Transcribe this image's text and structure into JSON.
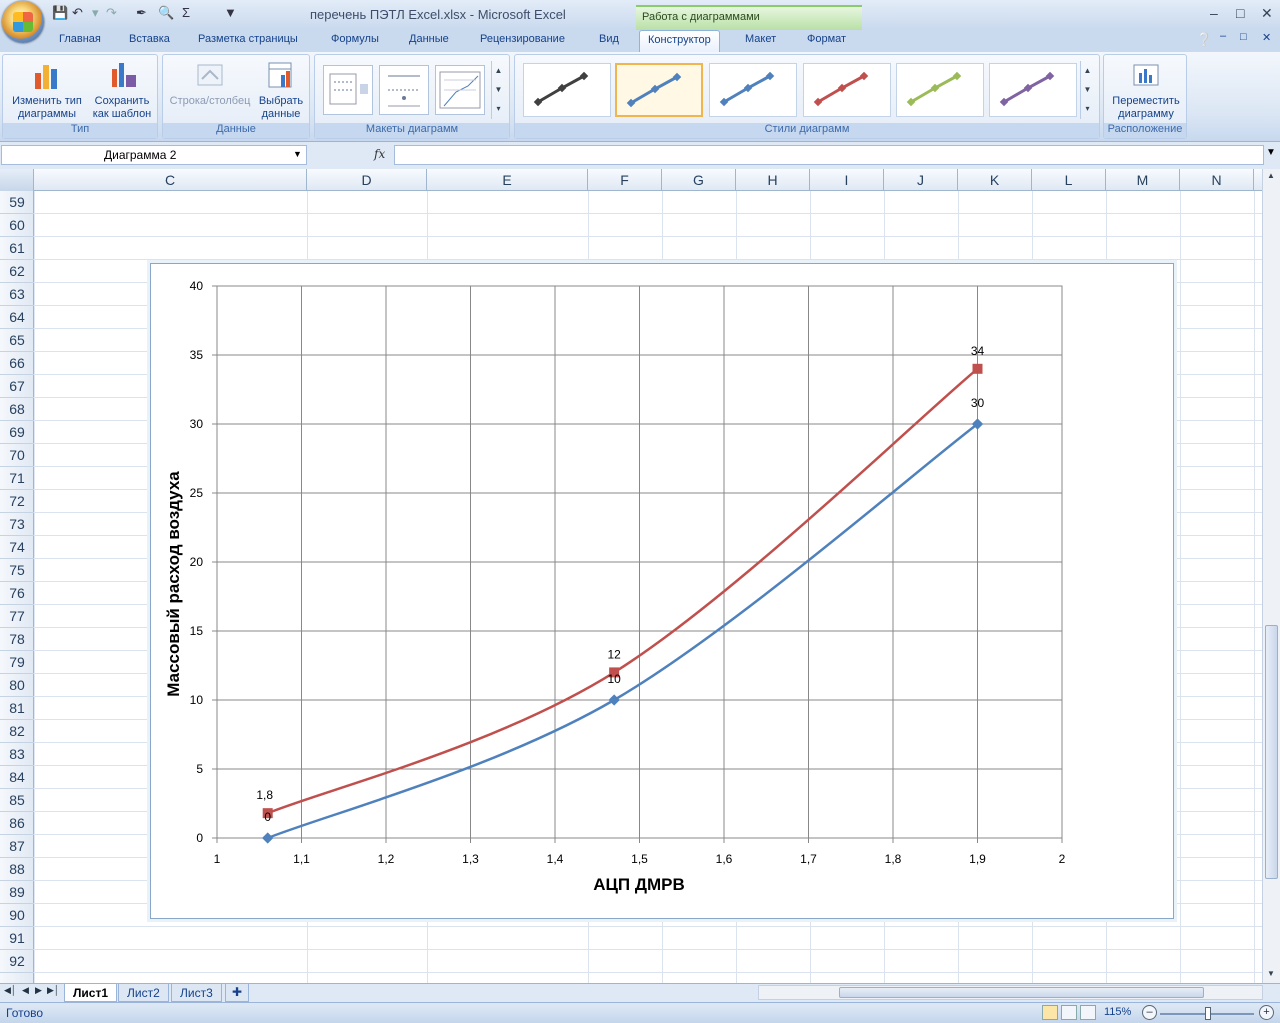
{
  "window": {
    "title": "перечень ПЭТЛ Excel.xlsx - Microsoft Excel",
    "context_tab_title": "Работа с диаграммами"
  },
  "ribbon_tabs": [
    "Главная",
    "Вставка",
    "Разметка страницы",
    "Формулы",
    "Данные",
    "Рецензирование",
    "Вид",
    "Конструктор",
    "Макет",
    "Формат"
  ],
  "active_tab": "Конструктор",
  "ribbon": {
    "type_group": {
      "label": "Тип",
      "change_type": "Изменить тип диаграммы",
      "save_template": "Сохранить как шаблон"
    },
    "data_group": {
      "label": "Данные",
      "switch_row_col": "Строка/столбец",
      "select_data": "Выбрать данные"
    },
    "layouts_group": {
      "label": "Макеты диаграмм"
    },
    "styles_group": {
      "label": "Стили диаграмм",
      "style_colors": [
        "#404040",
        "#4f81bd",
        "#4f81bd",
        "#c0504d",
        "#9bbb59",
        "#8064a2"
      ],
      "selected_index": 1
    },
    "location_group": {
      "label": "Расположение",
      "move_chart": "Переместить диаграмму"
    }
  },
  "formula_bar": {
    "name_box": "Диаграмма 2",
    "fx": "fx",
    "formula": ""
  },
  "columns": [
    "C",
    "D",
    "E",
    "F",
    "G",
    "H",
    "I",
    "J",
    "K",
    "L",
    "M",
    "N"
  ],
  "rows": [
    "59",
    "60",
    "61",
    "62",
    "63",
    "64",
    "65",
    "66",
    "67",
    "68",
    "69",
    "70",
    "71",
    "72",
    "73",
    "74",
    "75",
    "76",
    "77",
    "78",
    "79",
    "80",
    "81",
    "82",
    "83",
    "84",
    "85",
    "86",
    "87",
    "88",
    "89",
    "90",
    "91",
    "92"
  ],
  "chart_data": {
    "type": "scatter",
    "title": "",
    "xlabel": "АЦП ДМРВ",
    "ylabel": "Массовый расход воздуха",
    "xlim": [
      1,
      2
    ],
    "ylim": [
      0,
      40
    ],
    "x_ticks": [
      "1",
      "1,1",
      "1,2",
      "1,3",
      "1,4",
      "1,5",
      "1,6",
      "1,7",
      "1,8",
      "1,9",
      "2"
    ],
    "y_ticks": [
      "0",
      "5",
      "10",
      "15",
      "20",
      "25",
      "30",
      "35",
      "40"
    ],
    "grid": true,
    "smooth": true,
    "series": [
      {
        "color": "#4f81bd",
        "marker": "diamond",
        "x": [
          1.06,
          1.47,
          1.9
        ],
        "y": [
          0,
          10,
          30
        ],
        "labels": [
          "0",
          "10",
          "30"
        ]
      },
      {
        "color": "#c0504d",
        "marker": "square",
        "x": [
          1.06,
          1.47,
          1.9
        ],
        "y": [
          1.8,
          12,
          34
        ],
        "labels": [
          "1,8",
          "12",
          "34"
        ]
      }
    ]
  },
  "sheets": [
    "Лист1",
    "Лист2",
    "Лист3"
  ],
  "active_sheet": "Лист1",
  "status": {
    "text": "Готово",
    "zoom": "115%"
  }
}
